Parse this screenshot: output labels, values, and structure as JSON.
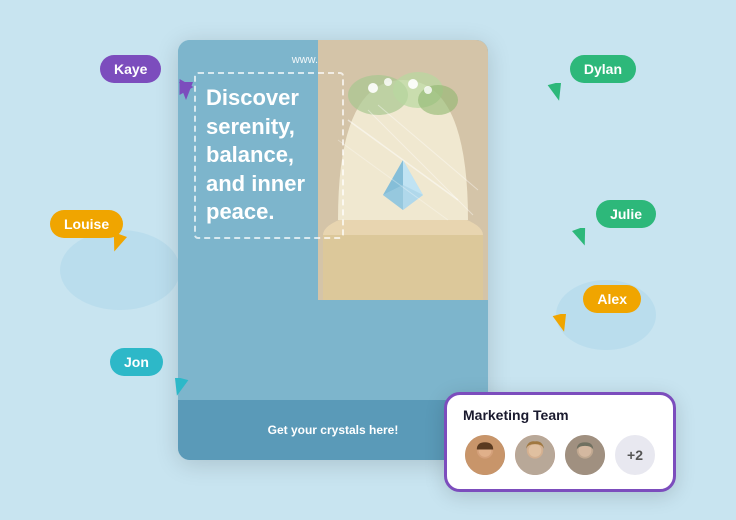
{
  "background": {
    "color": "#c8e4f0"
  },
  "card": {
    "url": "www.lumina.com",
    "headline": "Discover serenity, balance, and inner peace.",
    "cta": "Get your crystals here!"
  },
  "badges": [
    {
      "id": "kaye",
      "label": "Kaye",
      "color": "#7c4dbd",
      "position": "top-left"
    },
    {
      "id": "dylan",
      "label": "Dylan",
      "color": "#2db87a",
      "position": "top-right"
    },
    {
      "id": "louise",
      "label": "Louise",
      "color": "#f0a500",
      "position": "mid-left"
    },
    {
      "id": "julie",
      "label": "Julie",
      "color": "#2db87a",
      "position": "mid-right"
    },
    {
      "id": "alex",
      "label": "Alex",
      "color": "#f0a500",
      "position": "lower-right"
    },
    {
      "id": "jon",
      "label": "Jon",
      "color": "#2db8c8",
      "position": "lower-left"
    }
  ],
  "marketing_team": {
    "title": "Marketing Team",
    "extra_count": "+2",
    "avatars": [
      {
        "id": "avatar-1",
        "face_type": "1"
      },
      {
        "id": "avatar-2",
        "face_type": "2"
      },
      {
        "id": "avatar-3",
        "face_type": "3"
      }
    ]
  }
}
